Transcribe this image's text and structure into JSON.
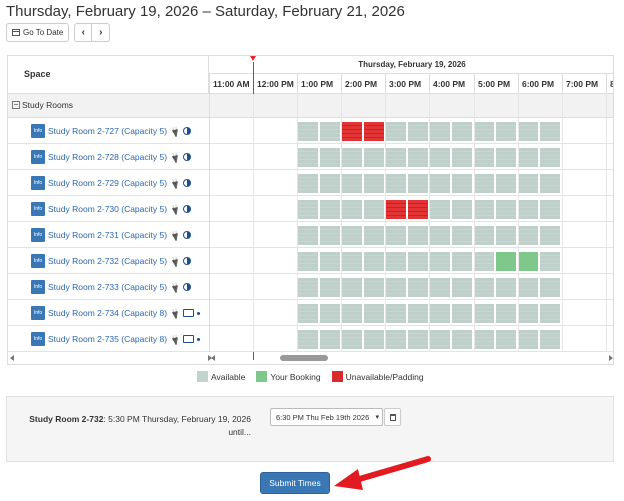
{
  "header": {
    "title": "Thursday, February 19, 2026 – Saturday, February 21, 2026",
    "goto_label": "Go To Date",
    "prev_label": "‹",
    "next_label": "›"
  },
  "grid": {
    "space_header": "Space",
    "date_header": "Thursday, February 19, 2026",
    "hours": [
      "11:00 AM",
      "12:00 PM",
      "1:00 PM",
      "2:00 PM",
      "3:00 PM",
      "4:00 PM",
      "5:00 PM",
      "6:00 PM",
      "7:00 PM",
      "8"
    ],
    "group_label": "Study Rooms",
    "info_label": "Info",
    "rooms": [
      {
        "name": "Study Room 2-727 (Capacity 5)",
        "icons": [
          "plug-icon",
          "half-circle-icon"
        ],
        "unavailable": [
          "2:00 PM",
          "2:30 PM"
        ],
        "booked": []
      },
      {
        "name": "Study Room 2-728 (Capacity 5)",
        "icons": [
          "plug-icon",
          "half-circle-icon"
        ],
        "unavailable": [],
        "booked": []
      },
      {
        "name": "Study Room 2-729 (Capacity 5)",
        "icons": [
          "plug-icon",
          "half-circle-icon"
        ],
        "unavailable": [],
        "booked": []
      },
      {
        "name": "Study Room 2-730 (Capacity 5)",
        "icons": [
          "plug-icon",
          "half-circle-icon"
        ],
        "unavailable": [
          "3:00 PM",
          "3:30 PM"
        ],
        "booked": []
      },
      {
        "name": "Study Room 2-731 (Capacity 5)",
        "icons": [
          "plug-icon",
          "half-circle-icon"
        ],
        "unavailable": [],
        "booked": []
      },
      {
        "name": "Study Room 2-732 (Capacity 5)",
        "icons": [
          "plug-icon",
          "half-circle-icon"
        ],
        "unavailable": [],
        "booked": [
          "5:30 PM",
          "6:00 PM"
        ]
      },
      {
        "name": "Study Room 2-733 (Capacity 5)",
        "icons": [
          "plug-icon",
          "half-circle-icon"
        ],
        "unavailable": [],
        "booked": []
      },
      {
        "name": "Study Room 2-734 (Capacity 8)",
        "icons": [
          "plug-icon",
          "monitor-icon",
          "dot-icon"
        ],
        "unavailable": [],
        "booked": []
      },
      {
        "name": "Study Room 2-735 (Capacity 8)",
        "icons": [
          "plug-icon",
          "monitor-icon",
          "dot-icon"
        ],
        "unavailable": [],
        "booked": []
      }
    ]
  },
  "legend": [
    {
      "label": "Available",
      "color": "#c3d3cf"
    },
    {
      "label": "Your Booking",
      "color": "#7dc88a"
    },
    {
      "label": "Unavailable/Padding",
      "color": "#d82b2b"
    }
  ],
  "booking": {
    "room": "Study Room 2-732",
    "start": ": 5:30 PM Thursday, February 19, 2026",
    "until": "until...",
    "end_value": "6:30 PM Thu Feb 19th 2026"
  },
  "submit_label": "Submit Times",
  "colors": {
    "accent": "#3a78b5",
    "arrow": "#e21b23"
  }
}
